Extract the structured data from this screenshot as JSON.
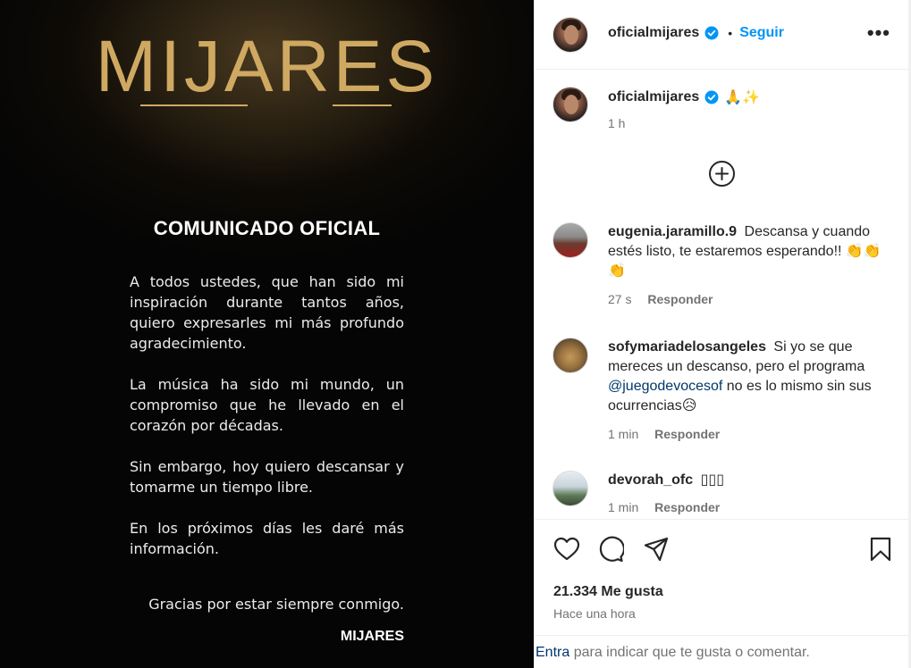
{
  "post": {
    "logo_text": "MIJARES",
    "heading": "COMUNICADO OFICIAL",
    "paragraphs": [
      "A todos ustedes, que han sido mi inspiración durante tantos años, quiero expresarles mi más profundo agradecimiento.",
      "La música ha sido mi mundo, un compromiso que he llevado en el corazón por décadas.",
      "Sin embargo, hoy quiero descansar y tomarme un tiempo libre.",
      "En los próximos días les daré más información."
    ],
    "thanks": "Gracias por estar siempre conmigo.",
    "signature": "MIJARES"
  },
  "header": {
    "username": "oficialmijares",
    "separator": "•",
    "follow_label": "Seguir",
    "more_label": "•••"
  },
  "caption": {
    "username": "oficialmijares",
    "emojis": "🙏✨",
    "time": "1 h"
  },
  "comments": [
    {
      "username": "eugenia.jaramillo.9",
      "text": "Descansa y cuando estés listo, te estaremos esperando!! 👏👏👏",
      "time": "27 s",
      "reply_label": "Responder"
    },
    {
      "username": "sofymariadelosangeles",
      "text_before": "Si yo se que mereces un descanso, pero el programa",
      "mention": "@juegodevocesof",
      "text_after": "no es lo mismo sin sus ocurrencias😥",
      "time": "1 min",
      "reply_label": "Responder"
    },
    {
      "username": "devorah_ofc",
      "text": "▯▯▯",
      "time": "1 min",
      "reply_label": "Responder"
    }
  ],
  "actions": {
    "icons": [
      "heart-icon",
      "comment-icon",
      "share-icon",
      "bookmark-icon"
    ],
    "likes": "21.334 Me gusta",
    "posted_ago": "Hace una hora"
  },
  "login_bar": {
    "link_label": "Entra",
    "rest": " para indicar que te gusta o comentar."
  },
  "colors": {
    "accent_blue": "#0095f6",
    "mention": "#00376b",
    "gold": "#cfa962",
    "muted": "#737373"
  }
}
